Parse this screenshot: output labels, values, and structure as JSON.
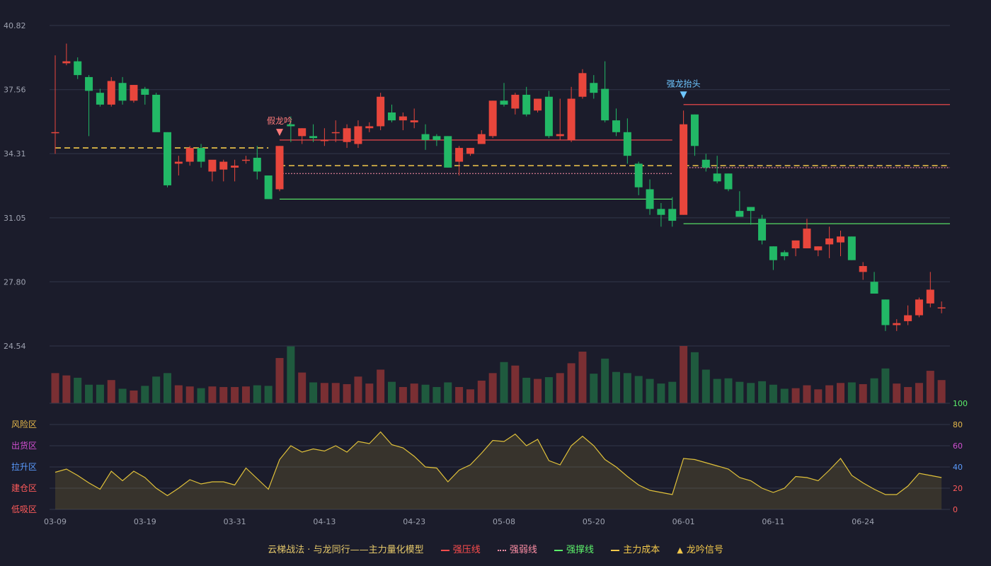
{
  "chart_data": [
    {
      "type": "candlestick",
      "title": "",
      "ylim": [
        24.54,
        40.82
      ],
      "y_ticks": [
        "40.82",
        "37.56",
        "34.31",
        "31.05",
        "27.80",
        "24.54"
      ],
      "x_tick_labels": [
        "03-09",
        "03-19",
        "03-31",
        "04-13",
        "04-23",
        "05-08",
        "05-20",
        "06-01",
        "06-11",
        "06-24"
      ],
      "x_tick_index": [
        0,
        8,
        16,
        24,
        32,
        40,
        48,
        56,
        64,
        72
      ],
      "ohlc": [
        [
          35.4,
          39.3,
          34.3,
          35.4
        ],
        [
          38.9,
          39.9,
          38.8,
          39.0
        ],
        [
          39.0,
          39.2,
          38.1,
          38.3
        ],
        [
          38.2,
          38.3,
          35.2,
          37.5
        ],
        [
          37.4,
          37.6,
          36.7,
          36.8
        ],
        [
          36.8,
          38.2,
          36.7,
          38.0
        ],
        [
          37.9,
          38.2,
          36.8,
          37.0
        ],
        [
          37.0,
          37.8,
          36.9,
          37.8
        ],
        [
          37.6,
          37.7,
          36.8,
          37.3
        ],
        [
          37.3,
          37.4,
          35.6,
          35.4
        ],
        [
          35.4,
          35.4,
          32.6,
          32.7
        ],
        [
          33.8,
          34.2,
          33.2,
          33.9
        ],
        [
          33.9,
          34.7,
          33.7,
          34.6
        ],
        [
          34.6,
          34.8,
          33.6,
          33.9
        ],
        [
          33.4,
          33.9,
          32.9,
          34.0
        ],
        [
          33.5,
          34.0,
          32.9,
          33.9
        ],
        [
          33.6,
          34.0,
          32.9,
          33.7
        ],
        [
          34.0,
          34.2,
          33.8,
          34.0
        ],
        [
          34.1,
          34.7,
          33.0,
          33.4
        ],
        [
          33.2,
          33.2,
          32.0,
          32.0
        ],
        [
          32.5,
          34.7,
          32.4,
          34.7
        ],
        [
          35.8,
          36.2,
          34.9,
          35.7
        ],
        [
          35.2,
          35.6,
          34.8,
          35.6
        ],
        [
          35.2,
          35.8,
          34.9,
          35.1
        ],
        [
          35.0,
          35.6,
          34.7,
          35.0
        ],
        [
          35.4,
          36.0,
          34.9,
          35.4
        ],
        [
          34.9,
          35.8,
          34.6,
          35.6
        ],
        [
          34.8,
          36.0,
          34.6,
          35.7
        ],
        [
          35.6,
          35.9,
          35.4,
          35.7
        ],
        [
          35.7,
          37.4,
          35.5,
          37.2
        ],
        [
          36.4,
          36.8,
          35.9,
          36.0
        ],
        [
          36.0,
          36.4,
          35.5,
          36.2
        ],
        [
          35.9,
          36.6,
          35.6,
          36.0
        ],
        [
          35.3,
          35.8,
          34.5,
          35.0
        ],
        [
          35.2,
          35.3,
          34.7,
          35.0
        ],
        [
          35.2,
          35.2,
          33.6,
          33.6
        ],
        [
          33.9,
          34.7,
          33.2,
          34.6
        ],
        [
          34.3,
          34.6,
          34.2,
          34.6
        ],
        [
          34.8,
          35.5,
          34.8,
          35.3
        ],
        [
          35.2,
          37.0,
          35.1,
          37.0
        ],
        [
          37.0,
          37.9,
          36.7,
          36.8
        ],
        [
          36.6,
          37.4,
          36.3,
          37.3
        ],
        [
          37.3,
          37.7,
          36.2,
          36.3
        ],
        [
          36.5,
          37.1,
          36.4,
          37.1
        ],
        [
          37.2,
          37.5,
          35.1,
          35.2
        ],
        [
          35.2,
          37.1,
          35.0,
          35.3
        ],
        [
          35.0,
          37.7,
          34.9,
          37.1
        ],
        [
          37.2,
          38.6,
          37.1,
          38.4
        ],
        [
          37.9,
          38.3,
          37.1,
          37.4
        ],
        [
          37.6,
          39.0,
          35.9,
          36.0
        ],
        [
          36.0,
          36.6,
          35.2,
          35.4
        ],
        [
          35.4,
          36.1,
          33.8,
          34.2
        ],
        [
          33.8,
          33.9,
          32.2,
          32.6
        ],
        [
          32.5,
          33.0,
          31.2,
          31.5
        ],
        [
          31.5,
          31.8,
          30.6,
          31.2
        ],
        [
          31.5,
          32.1,
          30.6,
          30.9
        ],
        [
          31.2,
          36.5,
          31.2,
          35.8
        ],
        [
          36.3,
          36.3,
          34.2,
          34.7
        ],
        [
          34.0,
          34.3,
          33.4,
          33.6
        ],
        [
          33.3,
          34.2,
          32.8,
          32.9
        ],
        [
          33.3,
          33.3,
          32.4,
          32.5
        ],
        [
          31.4,
          32.4,
          31.2,
          31.1
        ],
        [
          31.6,
          31.6,
          30.7,
          31.4
        ],
        [
          31.0,
          31.2,
          29.7,
          29.9
        ],
        [
          29.6,
          29.6,
          28.4,
          28.9
        ],
        [
          29.3,
          29.4,
          28.9,
          29.1
        ],
        [
          29.5,
          29.9,
          29.1,
          29.9
        ],
        [
          29.5,
          31.0,
          29.5,
          30.5
        ],
        [
          29.4,
          29.6,
          29.1,
          29.6
        ],
        [
          29.7,
          30.6,
          29.0,
          30.0
        ],
        [
          29.8,
          30.4,
          29.1,
          30.1
        ],
        [
          30.1,
          30.1,
          28.9,
          28.9
        ],
        [
          28.3,
          28.8,
          27.9,
          28.6
        ],
        [
          27.8,
          28.3,
          27.3,
          27.2
        ],
        [
          26.9,
          26.9,
          25.3,
          25.6
        ],
        [
          25.6,
          25.9,
          25.3,
          25.7
        ],
        [
          25.8,
          26.6,
          25.6,
          26.1
        ],
        [
          26.1,
          27.0,
          26.0,
          26.9
        ],
        [
          26.7,
          28.3,
          26.5,
          27.4
        ],
        [
          26.5,
          26.8,
          26.2,
          26.5
        ]
      ],
      "volume": [
        0.52,
        0.48,
        0.44,
        0.32,
        0.32,
        0.4,
        0.25,
        0.22,
        0.3,
        0.46,
        0.52,
        0.31,
        0.29,
        0.26,
        0.29,
        0.28,
        0.28,
        0.29,
        0.31,
        0.3,
        0.78,
        0.98,
        0.53,
        0.36,
        0.35,
        0.35,
        0.33,
        0.46,
        0.34,
        0.58,
        0.37,
        0.28,
        0.34,
        0.32,
        0.28,
        0.36,
        0.28,
        0.24,
        0.39,
        0.52,
        0.71,
        0.65,
        0.44,
        0.42,
        0.45,
        0.52,
        0.69,
        0.89,
        0.51,
        0.77,
        0.54,
        0.52,
        0.47,
        0.42,
        0.34,
        0.37,
        1.3,
        0.88,
        0.58,
        0.42,
        0.43,
        0.37,
        0.35,
        0.38,
        0.32,
        0.25,
        0.26,
        0.31,
        0.24,
        0.31,
        0.35,
        0.36,
        0.33,
        0.43,
        0.6,
        0.34,
        0.28,
        0.35,
        0.56,
        0.4
      ],
      "lines": {
        "strong_pressure": [
          {
            "from": 20,
            "to": 55,
            "y": 35.0
          },
          {
            "from": 56,
            "to": 80,
            "y": 36.8
          }
        ],
        "strong_weak": [
          {
            "from": 20,
            "to": 55,
            "y": 33.3
          },
          {
            "from": 56,
            "to": 80,
            "y": 33.6
          }
        ],
        "strong_support": [
          {
            "from": 20,
            "to": 55,
            "y": 32.0
          },
          {
            "from": 56,
            "to": 80,
            "y": 30.75
          }
        ],
        "main_cost": [
          {
            "from": 0,
            "to": 19,
            "y": 34.6
          },
          {
            "from": 20,
            "to": 55,
            "y": 33.7
          },
          {
            "from": 56,
            "to": 80,
            "y": 33.7
          }
        ]
      },
      "signals": [
        {
          "index": 20,
          "y": 35.1,
          "label": "假龙吟",
          "color": "#ff7a7a"
        },
        {
          "index": 56,
          "y": 37.0,
          "label": "强龙抬头",
          "color": "#6ec6ff"
        }
      ]
    },
    {
      "type": "area",
      "ylim": [
        0,
        100
      ],
      "y_ticks": [
        0,
        20,
        40,
        60,
        80,
        100
      ],
      "zones": [
        {
          "label": "风险区",
          "value": 80,
          "color": "#e6b84a"
        },
        {
          "label": "出货区",
          "value": 60,
          "color": "#d14fd1"
        },
        {
          "label": "拉升区",
          "value": 40,
          "color": "#5a9bff"
        },
        {
          "label": "建仓区",
          "value": 20,
          "color": "#ff5a5a"
        },
        {
          "label": "低吸区",
          "value": 0,
          "color": "#ff5a5a"
        }
      ],
      "values": [
        35,
        38,
        32,
        25,
        19,
        36,
        27,
        36,
        30,
        20,
        13,
        20,
        28,
        24,
        26,
        26,
        23,
        39,
        29,
        19,
        47,
        60,
        54,
        57,
        55,
        60,
        54,
        64,
        62,
        73,
        61,
        58,
        50,
        40,
        39,
        26,
        37,
        42,
        53,
        65,
        64,
        71,
        60,
        66,
        46,
        42,
        60,
        69,
        60,
        47,
        40,
        31,
        23,
        18,
        16,
        14,
        48,
        47,
        44,
        41,
        38,
        30,
        27,
        20,
        16,
        20,
        31,
        30,
        27,
        37,
        48,
        32,
        25,
        19,
        14,
        14,
        22,
        34,
        32,
        30
      ]
    }
  ],
  "legend": {
    "title": "云梯战法 · 与龙同行——主力量化模型",
    "items": [
      {
        "label": "强压线",
        "color": "#ff4d4d",
        "style": "solid"
      },
      {
        "label": "强弱线",
        "color": "#ff8fa6",
        "style": "dotted"
      },
      {
        "label": "强撑线",
        "color": "#5cf06a",
        "style": "solid"
      },
      {
        "label": "主力成本",
        "color": "#f2c84b",
        "style": "dashed"
      },
      {
        "label": "龙吟信号",
        "color": "#f2c84b",
        "style": "triangle"
      }
    ]
  },
  "colors": {
    "up": "#e8463c",
    "down": "#22b866",
    "grid": "#32364a",
    "axis_text": "#9ea2b0",
    "line": "#e0c13a"
  }
}
